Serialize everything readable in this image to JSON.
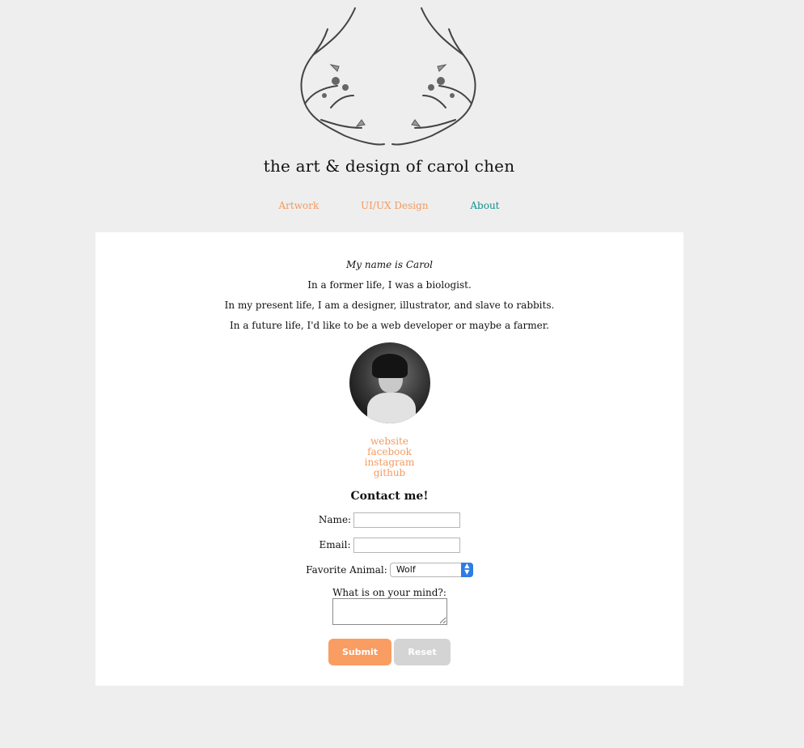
{
  "site": {
    "title": "the art & design of carol chen"
  },
  "nav": [
    {
      "label": "Artwork",
      "color": "#f49a5f"
    },
    {
      "label": "UI/UX Design",
      "color": "#f49a5f"
    },
    {
      "label": "About",
      "color": "#12908e"
    }
  ],
  "intro": {
    "name_line": "My name is Carol",
    "line1": "In a former life, I was a biologist.",
    "line2": "In my present life, I am a designer, illustrator, and slave to rabbits.",
    "line3": "In a future life, I'd like to be a web developer or maybe a farmer."
  },
  "links": {
    "website": "website",
    "facebook": "facebook",
    "instagram": "instagram",
    "github": "github"
  },
  "contact": {
    "title": "Contact me!",
    "name_label": "Name:",
    "name_value": "",
    "email_label": "Email:",
    "email_value": "",
    "animal_label": "Favorite Animal:",
    "animal_value": "Wolf",
    "mind_label": "What is on your mind?:",
    "mind_value": "",
    "submit_label": "Submit",
    "reset_label": "Reset"
  },
  "colors": {
    "accent": "#f49a5f",
    "active_nav": "#12908e",
    "background": "#eeeeee",
    "card": "#ffffff"
  },
  "icons": {
    "logo": "antlers-illustration",
    "select": "chevron-updown-icon"
  }
}
